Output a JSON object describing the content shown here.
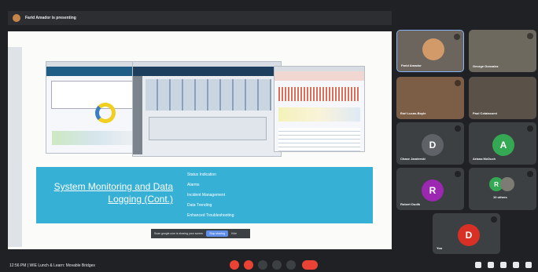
{
  "topbar": {
    "presenting_text": "Farid Amador is presenting"
  },
  "slide": {
    "title": "System Monitoring and Data Logging (Cont.)",
    "bullets": [
      "Status Indication",
      "Alarms",
      "Incident Management",
      "Data Trending",
      "Enhanced Troubleshooting"
    ]
  },
  "share_bar": {
    "notice": "Scan google.com is sharing your screen",
    "stop_label": "Stop sharing",
    "hide_label": "Hide"
  },
  "participants": [
    {
      "name": "Farid Amador",
      "type": "video",
      "active": true
    },
    {
      "name": "George Gonzalez",
      "type": "video"
    },
    {
      "name": "Earl Lucas-Boyle",
      "type": "video"
    },
    {
      "name": "Paul Colaiacomi",
      "type": "video"
    },
    {
      "name": "Chase Janderski",
      "initial": "D",
      "color": "#3c4043",
      "avatar_color": "#5f6368"
    },
    {
      "name": "Ariana McDuch",
      "initial": "A",
      "color": "#3c4043",
      "avatar_color": "#34a853"
    },
    {
      "name": "Robert Dudik",
      "initial": "R",
      "color": "#3c4043",
      "avatar_color": "#9c27b0"
    },
    {
      "name": "10 others",
      "initial": "R",
      "color": "#3c4043",
      "avatar_color": "#34a853"
    },
    {
      "name": "You",
      "initial": "D",
      "color": "#3c4043",
      "avatar_color": "#d93025"
    }
  ],
  "bottom": {
    "time": "12:56 PM",
    "meeting_title": "WIE Lunch & Learn: Movable Bridges"
  }
}
